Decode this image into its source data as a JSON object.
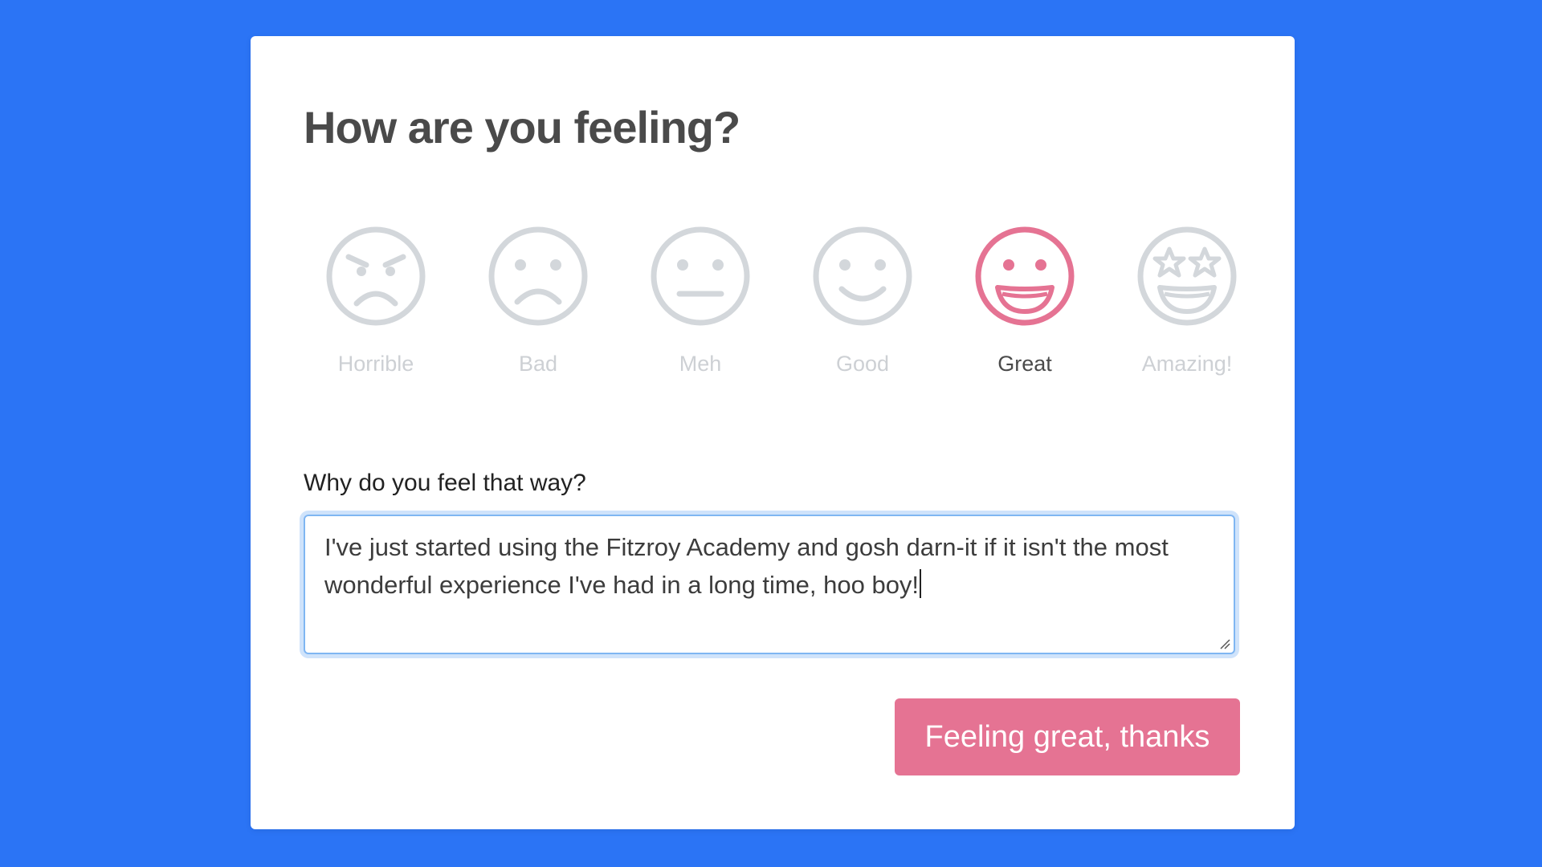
{
  "page": {
    "background_color": "#2b74f5",
    "accent_color": "#e57393",
    "inactive_color": "#d3d7db"
  },
  "form": {
    "title": "How are you feeling?",
    "moods": [
      {
        "label": "Horrible",
        "icon": "angry-face-icon",
        "selected": false
      },
      {
        "label": "Bad",
        "icon": "sad-face-icon",
        "selected": false
      },
      {
        "label": "Meh",
        "icon": "neutral-face-icon",
        "selected": false
      },
      {
        "label": "Good",
        "icon": "smiling-face-icon",
        "selected": false
      },
      {
        "label": "Great",
        "icon": "grinning-face-icon",
        "selected": true
      },
      {
        "label": "Amazing!",
        "icon": "star-struck-face-icon",
        "selected": false
      }
    ],
    "selected_mood": "Great",
    "question": "Why do you feel that way?",
    "reason_text": "I've just started using the Fitzroy Academy and gosh darn-it if it isn't the most wonderful experience I've had in a long time, hoo boy!",
    "submit_label": "Feeling great, thanks"
  }
}
